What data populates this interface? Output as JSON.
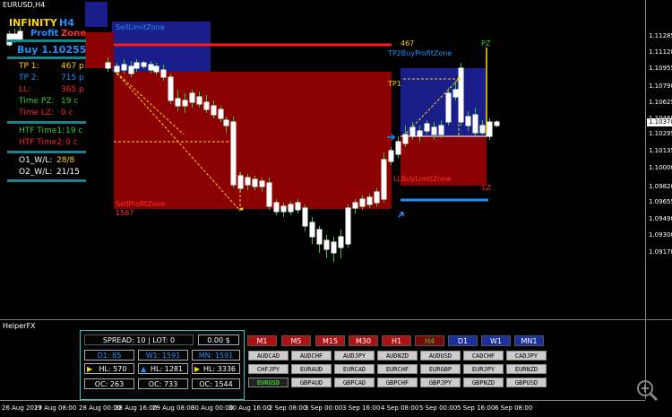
{
  "window": {
    "chart_title": "EURUSD,H4",
    "helper_title": "HelperFX"
  },
  "price_axis": {
    "labels": [
      "1.11285",
      "1.11120",
      "1.10955",
      "1.10790",
      "1.10625",
      "1.10460",
      "1.10370",
      "1.10295",
      "1.10135",
      "1.10000",
      "1.09820",
      "1.09655",
      "1.09490",
      "1.09300",
      "1.09170"
    ],
    "current_price": "1.10370"
  },
  "time_axis": [
    "26 Aug 2019",
    "27 Aug 08:00",
    "28 Aug 00:00",
    "28 Aug 16:00",
    "29 Aug 08:00",
    "30 Aug 00:00",
    "30 Aug 16:00",
    "2 Sep 08:00",
    "3 Sep 00:00",
    "3 Sep 16:00",
    "4 Sep 08:00",
    "5 Sep 00:00",
    "5 Sep 16:00",
    "6 Sep 08:00"
  ],
  "info_panel": {
    "name_line1": "INFINITY",
    "name_tf": "H4",
    "name_profit": "Profit",
    "name_zone": "Zone",
    "buy_label": "Buy 1.10255",
    "rows": [
      {
        "label": "TP 1:",
        "value": "467 p",
        "label_color": "#ffd700",
        "value_color": "#ffd700"
      },
      {
        "label": "TP 2:",
        "value": "715 p",
        "label_color": "#1e90ff",
        "value_color": "#1e90ff"
      },
      {
        "label": "LL:",
        "value": "365 p",
        "label_color": "#ff2020",
        "value_color": "#ff2020"
      },
      {
        "label": "Time PZ:",
        "value": "19 c",
        "label_color": "#32cd32",
        "value_color": "#32cd32"
      },
      {
        "label": "Time LZ:",
        "value": "0 c",
        "label_color": "#ff2020",
        "value_color": "#ff2020"
      }
    ],
    "htf1_label": "HTF Time1:",
    "htf1_value": "19 c",
    "htf2_label": "HTF Time2:",
    "htf2_value": "0 c",
    "o1_label": "O1_W/L:",
    "o1_value": "28/8",
    "o2_label": "O2_W/L:",
    "o2_value": "21/15"
  },
  "zones": {
    "sell_limit": "SellLimitZone",
    "sell_profit": "SellProfitZone",
    "sell_profit_value": "1567",
    "tp2_buy_profit": "TP2BuyProfitZone",
    "tp1": "TP1",
    "pz": "PZ",
    "ll_buy_limit": "LLBuyLimitZone",
    "lz": "LZ",
    "tp2_value": "467"
  },
  "helper": {
    "spread_lot": "SPREAD: 10  |  LOT: 0",
    "balance": "0.00 $",
    "d1": "D1: 85",
    "w1": "W1: 1591",
    "mn": "MN: 1591",
    "hl1": "HL: 570",
    "hl2": "HL: 1281",
    "hl3": "HL: 3336",
    "oc1": "OC: 263",
    "oc2": "OC: 733",
    "oc3": "OC: 1544",
    "timeframes": [
      {
        "label": "M1",
        "style": "red"
      },
      {
        "label": "M5",
        "style": "red"
      },
      {
        "label": "M15",
        "style": "red"
      },
      {
        "label": "M30",
        "style": "red"
      },
      {
        "label": "H1",
        "style": "red"
      },
      {
        "label": "H4",
        "style": "active"
      },
      {
        "label": "D1",
        "style": "blue"
      },
      {
        "label": "W1",
        "style": "blue"
      },
      {
        "label": "MN1",
        "style": "blue"
      }
    ],
    "pairs": [
      [
        "AUDCAD",
        "AUDCHF",
        "AUDJPY",
        "AUDNZD",
        "AUDUSD",
        "CADCHF",
        "CADJPY"
      ],
      [
        "CHFJPY",
        "EURAUD",
        "EURCAD",
        "EURCHF",
        "EURGBP",
        "EURJPY",
        "EURNZD"
      ],
      [
        "EURUSD",
        "GBPAUD",
        "GBPCAD",
        "GBPCHF",
        "GBPJPY",
        "GBPNZD",
        "GBPUSD"
      ]
    ],
    "active_pair": "EURUSD"
  },
  "colors": {
    "tf_red": "#b01010",
    "tf_active": "#7a0a0a",
    "tf_blue": "#1830a0",
    "active_pair_text": "#32cd32"
  }
}
